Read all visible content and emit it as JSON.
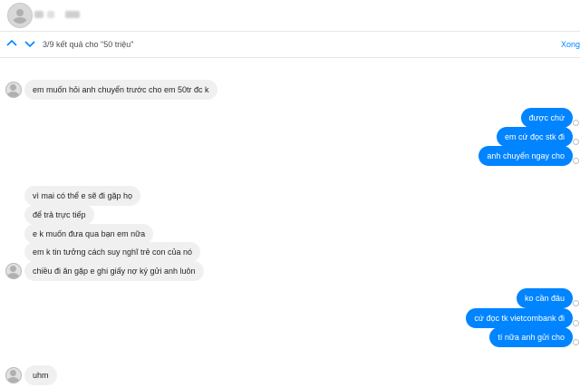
{
  "search": {
    "result_text": "3/9 kết quả cho \"50 triệu\"",
    "done_label": "Xong",
    "prev_icon": "chevron-up-icon",
    "next_icon": "chevron-down-icon"
  },
  "colors": {
    "outgoing": "#0084ff",
    "incoming": "#f1f0f0",
    "accent": "#0084ff"
  },
  "messages": [
    {
      "side": "in",
      "text": "em muốn hỏi anh chuyển trước cho em 50tr đc k"
    },
    {
      "side": "out",
      "text": "được chứ"
    },
    {
      "side": "out",
      "text": "em cứ đọc stk đi"
    },
    {
      "side": "out",
      "text": "anh chuyển ngay cho"
    },
    {
      "side": "in",
      "text": "vì mai có thể e sẽ đi gặp họ"
    },
    {
      "side": "in",
      "text": "để trả trực tiếp"
    },
    {
      "side": "in",
      "text": "e k muốn đưa qua bạn em nữa"
    },
    {
      "side": "in",
      "text": "em k tin tưởng cách suy nghĩ trẻ con của nó"
    },
    {
      "side": "in",
      "text": "chiều đi ăn gặp e ghi giấy nợ ký gửi anh luôn"
    },
    {
      "side": "out",
      "text": "ko cần đâu"
    },
    {
      "side": "out",
      "text": "cứ đọc tk vietcombank đi"
    },
    {
      "side": "out",
      "text": "tí nữa anh gửi cho"
    },
    {
      "side": "in",
      "text": "uhm"
    }
  ]
}
